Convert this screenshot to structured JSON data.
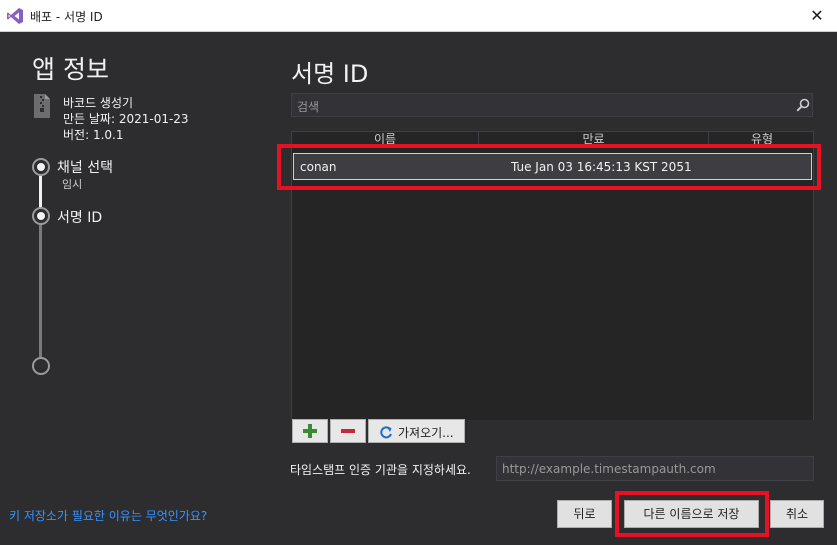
{
  "window": {
    "title": "배포 - 서명 ID",
    "close_glyph": "✕"
  },
  "left": {
    "heading": "앱 정보",
    "package_name": "바코드 생성기",
    "created": "만든 날짜: 2021-01-23",
    "version": "버전: 1.0.1",
    "steps": [
      {
        "label": "채널 선택",
        "sub": "임시"
      },
      {
        "label": "서명 ID",
        "sub": ""
      }
    ],
    "help_link": "키 저장소가 필요한 이유는 무엇인가요?"
  },
  "main": {
    "title": "서명 ID",
    "search_placeholder": "검색",
    "table": {
      "columns": [
        "이름",
        "만료",
        "유형"
      ],
      "rows": [
        {
          "name": "conan",
          "expires": "Tue Jan 03 16:45:13 KST 2051",
          "type": ""
        }
      ]
    },
    "toolbar": {
      "add_glyph": "+",
      "remove_glyph": "−",
      "import_label": "가져오기..."
    },
    "timestamp_label": "타임스탬프 인증 기관을 지정하세요.",
    "timestamp_placeholder": "http://example.timestampauth.com"
  },
  "footer": {
    "back": "뒤로",
    "save_as": "다른 이름으로 저장",
    "cancel": "취소"
  },
  "colors": {
    "background": "#2d2d30",
    "highlight": "#e81123",
    "link": "#3794ff",
    "vs_purple": "#865fc5",
    "add_green": "#388a34",
    "remove_red": "#c5283d"
  }
}
